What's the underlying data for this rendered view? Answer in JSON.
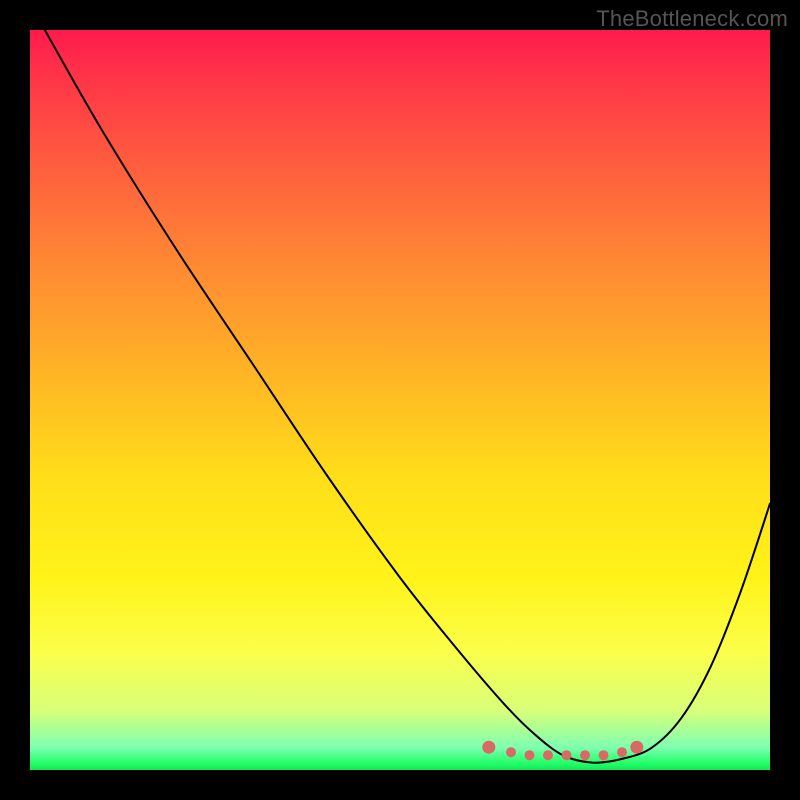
{
  "watermark": "TheBottleneck.com",
  "chart_data": {
    "type": "line",
    "title": "",
    "xlabel": "",
    "ylabel": "",
    "xlim": [
      0,
      100
    ],
    "ylim": [
      0,
      100
    ],
    "note": "Bottleneck-style curve: steep descent from top-left to a wide minimum near x≈74, then rising toward the right edge. Y is inverted visually (0 at top of gradient).",
    "series": [
      {
        "name": "curve",
        "x": [
          2,
          10,
          20,
          30,
          40,
          50,
          58,
          64,
          68,
          72,
          76,
          80,
          84,
          88,
          92,
          96,
          100
        ],
        "y": [
          0,
          14,
          30,
          45,
          60,
          74,
          84,
          91,
          95,
          98,
          99,
          98.5,
          97,
          93,
          86,
          76,
          64
        ]
      }
    ],
    "minimum_marker": {
      "x_range": [
        62,
        82
      ],
      "y": 98,
      "points_x": [
        62,
        65,
        67.5,
        70,
        72.5,
        75,
        77.5,
        80,
        82
      ]
    },
    "gradient": {
      "top_color": "#ff1a4d",
      "bottom_color": "#12e85a",
      "description": "Vertical red-to-green heat gradient"
    }
  }
}
